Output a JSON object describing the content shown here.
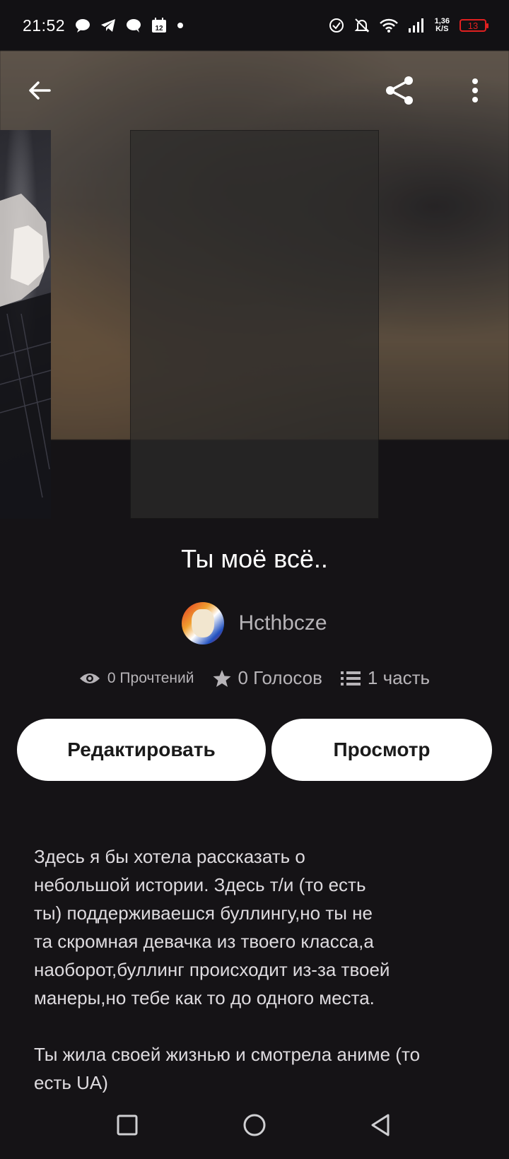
{
  "status_bar": {
    "time": "21:52",
    "net_speed_value": "1,36",
    "net_speed_unit": "K/S",
    "battery": "13",
    "left_icons": [
      "chat-bubble-icon",
      "telegram-icon",
      "message-icon",
      "calendar-icon",
      "dot-icon"
    ],
    "right_icons": [
      "sync-icon",
      "mute-bell-icon",
      "wifi-icon",
      "signal-icon"
    ],
    "calendar_day": "12"
  },
  "header": {
    "back_icon": "arrow-left-icon",
    "share_icon": "share-icon",
    "more_icon": "more-vertical-icon"
  },
  "story": {
    "title": "Ты моё всё..",
    "author": "Hcthbcze"
  },
  "stats": {
    "reads": "0 Прочтений",
    "votes": "0 Голосов",
    "parts": "1 часть"
  },
  "actions": {
    "edit_label": "Редактировать",
    "view_label": "Просмотр"
  },
  "description": "Здесь я бы хотела рассказать о\nнебольшой истории. Здесь т/и (то есть\nты) поддерживаешся буллингу,но ты не\nта скромная девачка из твоего класса,а\nнаоборот,буллинг происходит из-за твоей\nманеры,но тебе как то до одного места.\n\nТы жила своей жизнью и смотрела аниме (то\nесть UA)",
  "colors": {
    "background": "#151316",
    "button_bg": "#ffffff",
    "battery_low": "#e02020"
  }
}
